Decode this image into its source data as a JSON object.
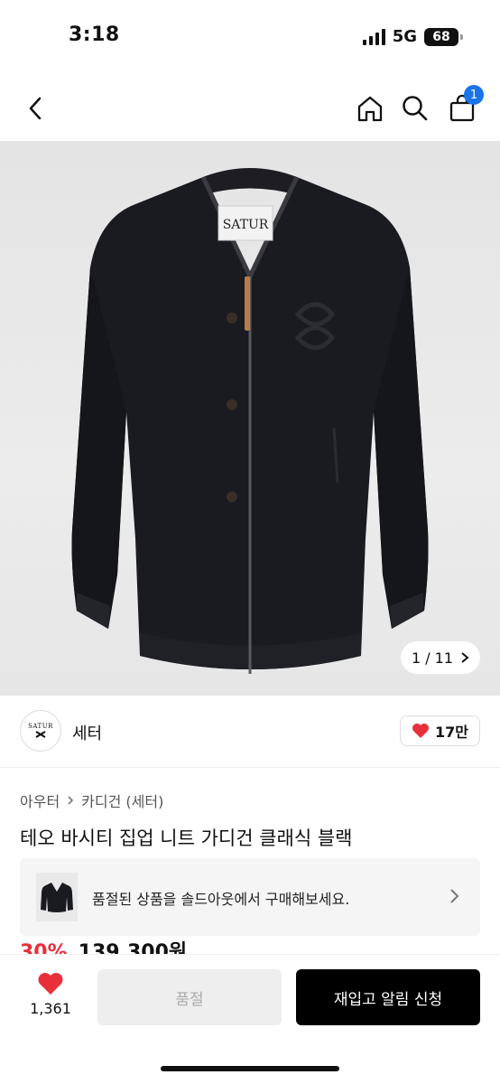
{
  "status_bar": {
    "time": "3:18",
    "network": "5G",
    "battery": "68"
  },
  "nav": {
    "cart_count": "1"
  },
  "product_image": {
    "counter_text": "1 / 11",
    "label_text": "SATUR",
    "current_index": 1,
    "total": 11
  },
  "brand": {
    "logo_text": "SATUR",
    "name": "세터",
    "likes": "17만"
  },
  "breadcrumb": {
    "level1": "아우터",
    "level2": "카디건 (세터)"
  },
  "product": {
    "title": "테오 바시티 집업 니트 가디건 클래식 블랙",
    "discount_partial": "30%",
    "price_partial": "139,300원"
  },
  "soldout_banner": {
    "text": "품절된 상품을 솔드아웃에서 구매해보세요."
  },
  "bottom_bar": {
    "wish_count": "1,361",
    "soldout_label": "품절",
    "restock_label": "재입고 알림 신청"
  },
  "colors": {
    "accent_red": "#e8303a",
    "badge_blue": "#1a73e8",
    "primary_black": "#000000"
  }
}
